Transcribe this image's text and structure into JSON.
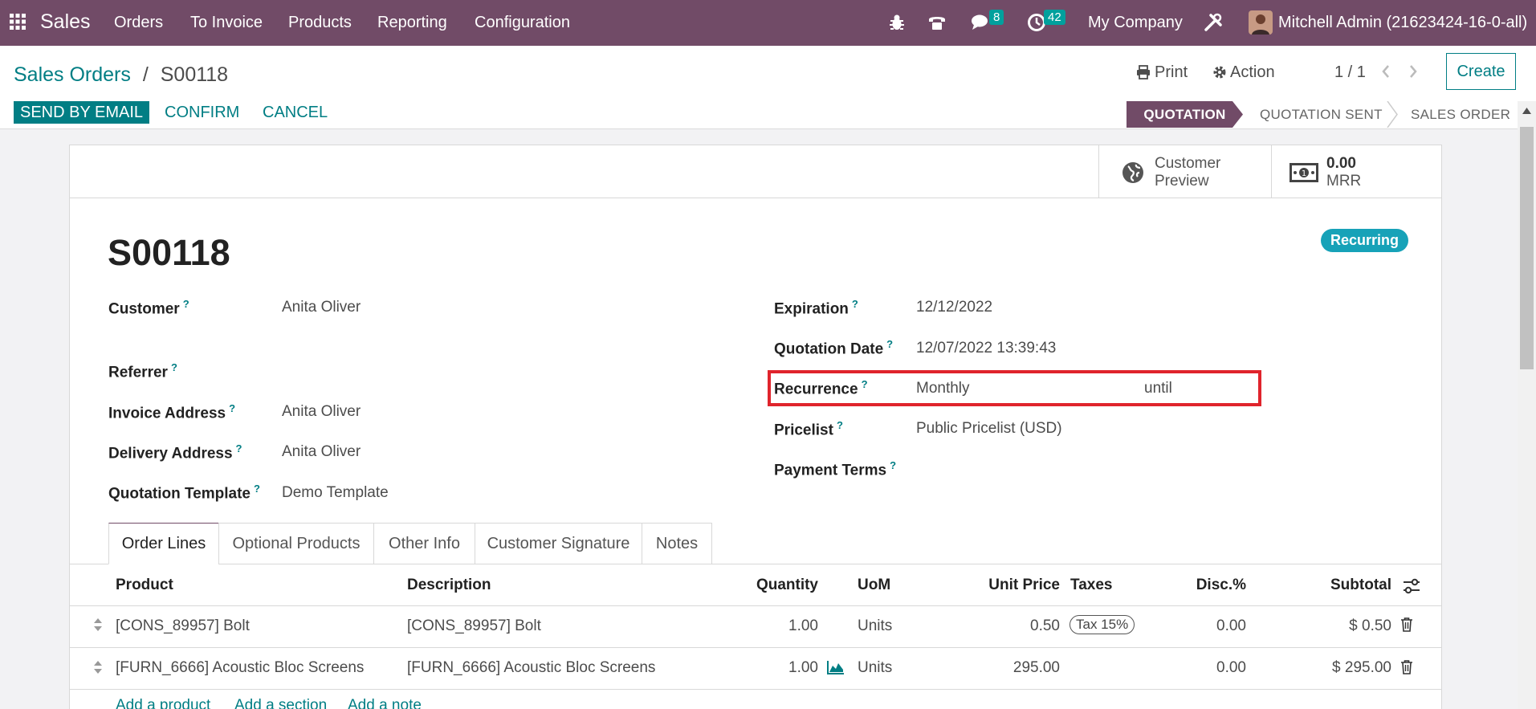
{
  "navbar": {
    "app_name": "Sales",
    "menu": [
      "Orders",
      "To Invoice",
      "Products",
      "Reporting",
      "Configuration"
    ],
    "messages_count": "8",
    "activities_count": "42",
    "company": "My Company",
    "user": "Mitchell Admin (21623424-16-0-all)"
  },
  "breadcrumb": {
    "parent": "Sales Orders",
    "separator": "/",
    "current": "S00118"
  },
  "control_panel": {
    "print_label": "Print",
    "action_label": "Action",
    "pager": "1 / 1",
    "create_label": "Create"
  },
  "statusbar": {
    "send_email_label": "SEND BY EMAIL",
    "confirm_label": "CONFIRM",
    "cancel_label": "CANCEL",
    "stages": [
      "QUOTATION",
      "QUOTATION SENT",
      "SALES ORDER"
    ],
    "active_stage": "QUOTATION"
  },
  "button_box": {
    "customer_preview_line1": "Customer",
    "customer_preview_line2": "Preview",
    "mrr_value": "0.00",
    "mrr_label": "MRR"
  },
  "record": {
    "name": "S00118",
    "badge": "Recurring"
  },
  "fields_left": {
    "customer_label": "Customer",
    "customer_value": "Anita Oliver",
    "referrer_label": "Referrer",
    "referrer_value": "",
    "invoice_address_label": "Invoice Address",
    "invoice_address_value": "Anita Oliver",
    "delivery_address_label": "Delivery Address",
    "delivery_address_value": "Anita Oliver",
    "quotation_template_label": "Quotation Template",
    "quotation_template_value": "Demo Template"
  },
  "fields_right": {
    "expiration_label": "Expiration",
    "expiration_value": "12/12/2022",
    "quotation_date_label": "Quotation Date",
    "quotation_date_value": "12/07/2022 13:39:43",
    "recurrence_label": "Recurrence",
    "recurrence_value": "Monthly",
    "recurrence_until": "until",
    "pricelist_label": "Pricelist",
    "pricelist_value": "Public Pricelist (USD)",
    "payment_terms_label": "Payment Terms",
    "payment_terms_value": ""
  },
  "help_marker": "?",
  "tabs": [
    "Order Lines",
    "Optional Products",
    "Other Info",
    "Customer Signature",
    "Notes"
  ],
  "active_tab": "Order Lines",
  "order_lines": {
    "columns": {
      "product": "Product",
      "description": "Description",
      "quantity": "Quantity",
      "uom": "UoM",
      "unit_price": "Unit Price",
      "taxes": "Taxes",
      "discount": "Disc.%",
      "subtotal": "Subtotal"
    },
    "rows": [
      {
        "product": "[CONS_89957] Bolt",
        "description": "[CONS_89957] Bolt",
        "quantity": "1.00",
        "uom": "Units",
        "unit_price": "0.50",
        "taxes": "Tax 15%",
        "discount": "0.00",
        "subtotal": "$ 0.50"
      },
      {
        "product": "[FURN_6666] Acoustic Bloc Screens",
        "description": "[FURN_6666] Acoustic Bloc Screens",
        "quantity": "1.00",
        "uom": "Units",
        "unit_price": "295.00",
        "taxes": "",
        "discount": "0.00",
        "subtotal": "$ 295.00"
      }
    ],
    "add_product": "Add a product",
    "add_section": "Add a section",
    "add_note": "Add a note"
  },
  "colors": {
    "brand": "#714b67",
    "accent": "#017e84",
    "badge": "#17a2b8",
    "highlight": "#e0242c"
  }
}
